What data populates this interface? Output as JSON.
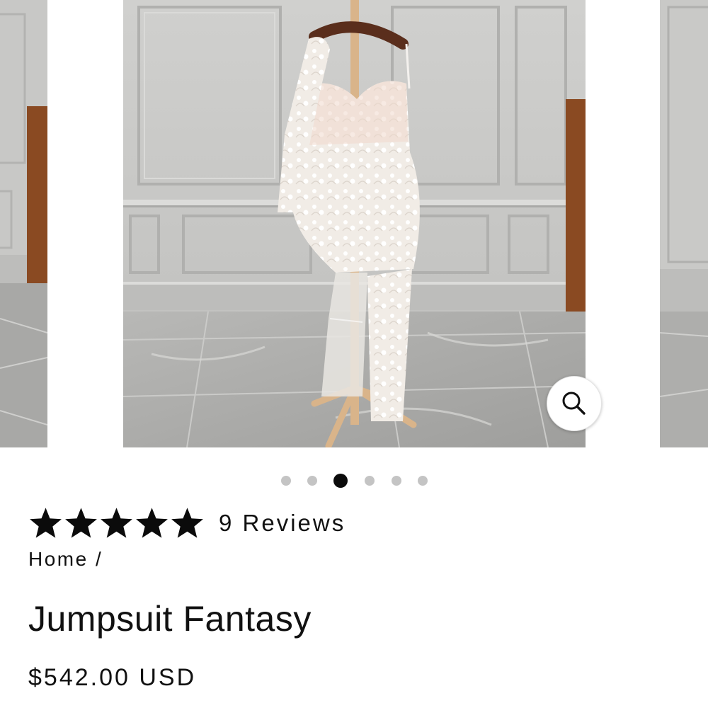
{
  "carousel": {
    "zoom_icon": "magnifier-icon",
    "dots_total": 6,
    "active_index": 2
  },
  "rating": {
    "stars": 5,
    "star_icon": "star-icon",
    "reviews_label": "9 Reviews"
  },
  "breadcrumb": {
    "home": "Home",
    "separator": "/"
  },
  "product": {
    "title": "Jumpsuit Fantasy",
    "price": "$542.00 USD"
  }
}
